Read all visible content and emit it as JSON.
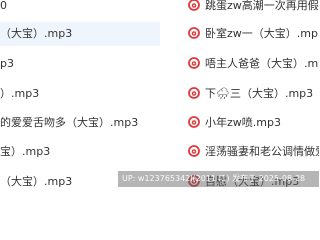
{
  "left_column": {
    "items": [
      {
        "label": "0"
      },
      {
        "label": "（大宝）.mp3",
        "highlighted": true
      },
      {
        "label": "p3"
      },
      {
        "label": "）.mp3"
      },
      {
        "label": "的爱爱舌吻多（大宝）.mp3"
      },
      {
        "label": "宝）.mp3"
      },
      {
        "label": "（大宝）.mp3"
      }
    ]
  },
  "right_column": {
    "items": [
      {
        "label": "跳蛋zw高潮一次再用假阳",
        "icon": "netease-music-icon"
      },
      {
        "label": "卧室zw一（大宝）.mp3",
        "icon": "netease-music-icon"
      },
      {
        "label": "唔主人爸爸（大宝）.mp3",
        "icon": "netease-music-icon"
      },
      {
        "label": "下🌧三（大宝）.mp3",
        "icon": "netease-music-icon"
      },
      {
        "label": "小年zw喷.mp3",
        "icon": "netease-music-icon"
      },
      {
        "label": "淫荡骚妻和老公调情做爱",
        "icon": "netease-music-icon"
      },
      {
        "label": "自慰（大宝）.mp3",
        "icon": "netease-music-icon"
      }
    ]
  },
  "watermark": {
    "text": "UP: w123765342l(2011 f1) 发布于 2025-08-28"
  },
  "colors": {
    "icon": "#e0393e",
    "highlight": "#eef5fd",
    "text": "#333333"
  }
}
